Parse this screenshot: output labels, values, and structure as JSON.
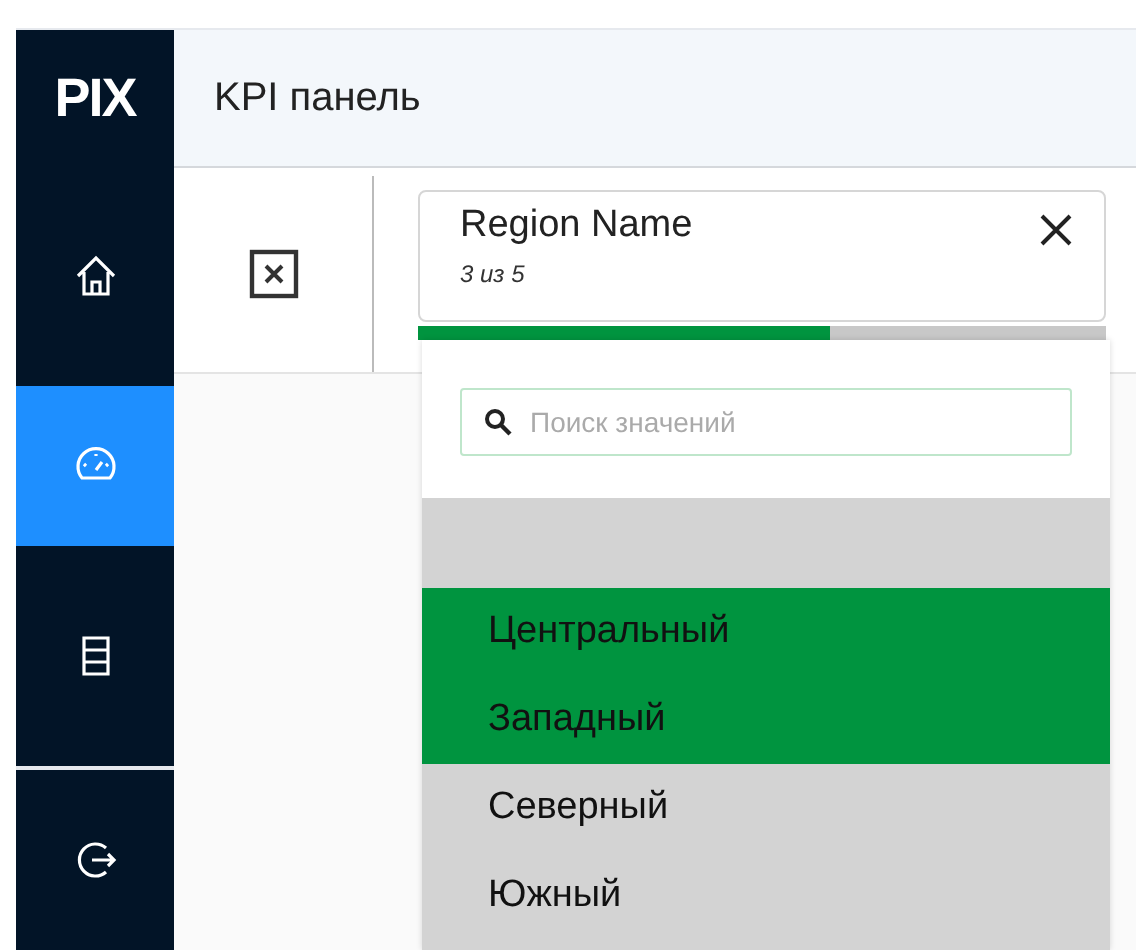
{
  "logo": "PIX",
  "sidebar": {
    "items": [
      {
        "kind": "home",
        "selected": false
      },
      {
        "kind": "gauge",
        "selected": true
      },
      {
        "kind": "sheets",
        "selected": false
      },
      {
        "kind": "logout",
        "selected": false
      }
    ]
  },
  "header": {
    "title": "KPI панель"
  },
  "filter": {
    "field": "Region Name",
    "count": "3 из 5",
    "level": 0.6,
    "search": {
      "placeholder": "Поиск значений"
    },
    "values": [
      {
        "label": "Центральный",
        "selected": true
      },
      {
        "label": "Западный",
        "selected": true
      },
      {
        "label": "Северный",
        "selected": false
      },
      {
        "label": "Южный",
        "selected": false
      }
    ]
  }
}
